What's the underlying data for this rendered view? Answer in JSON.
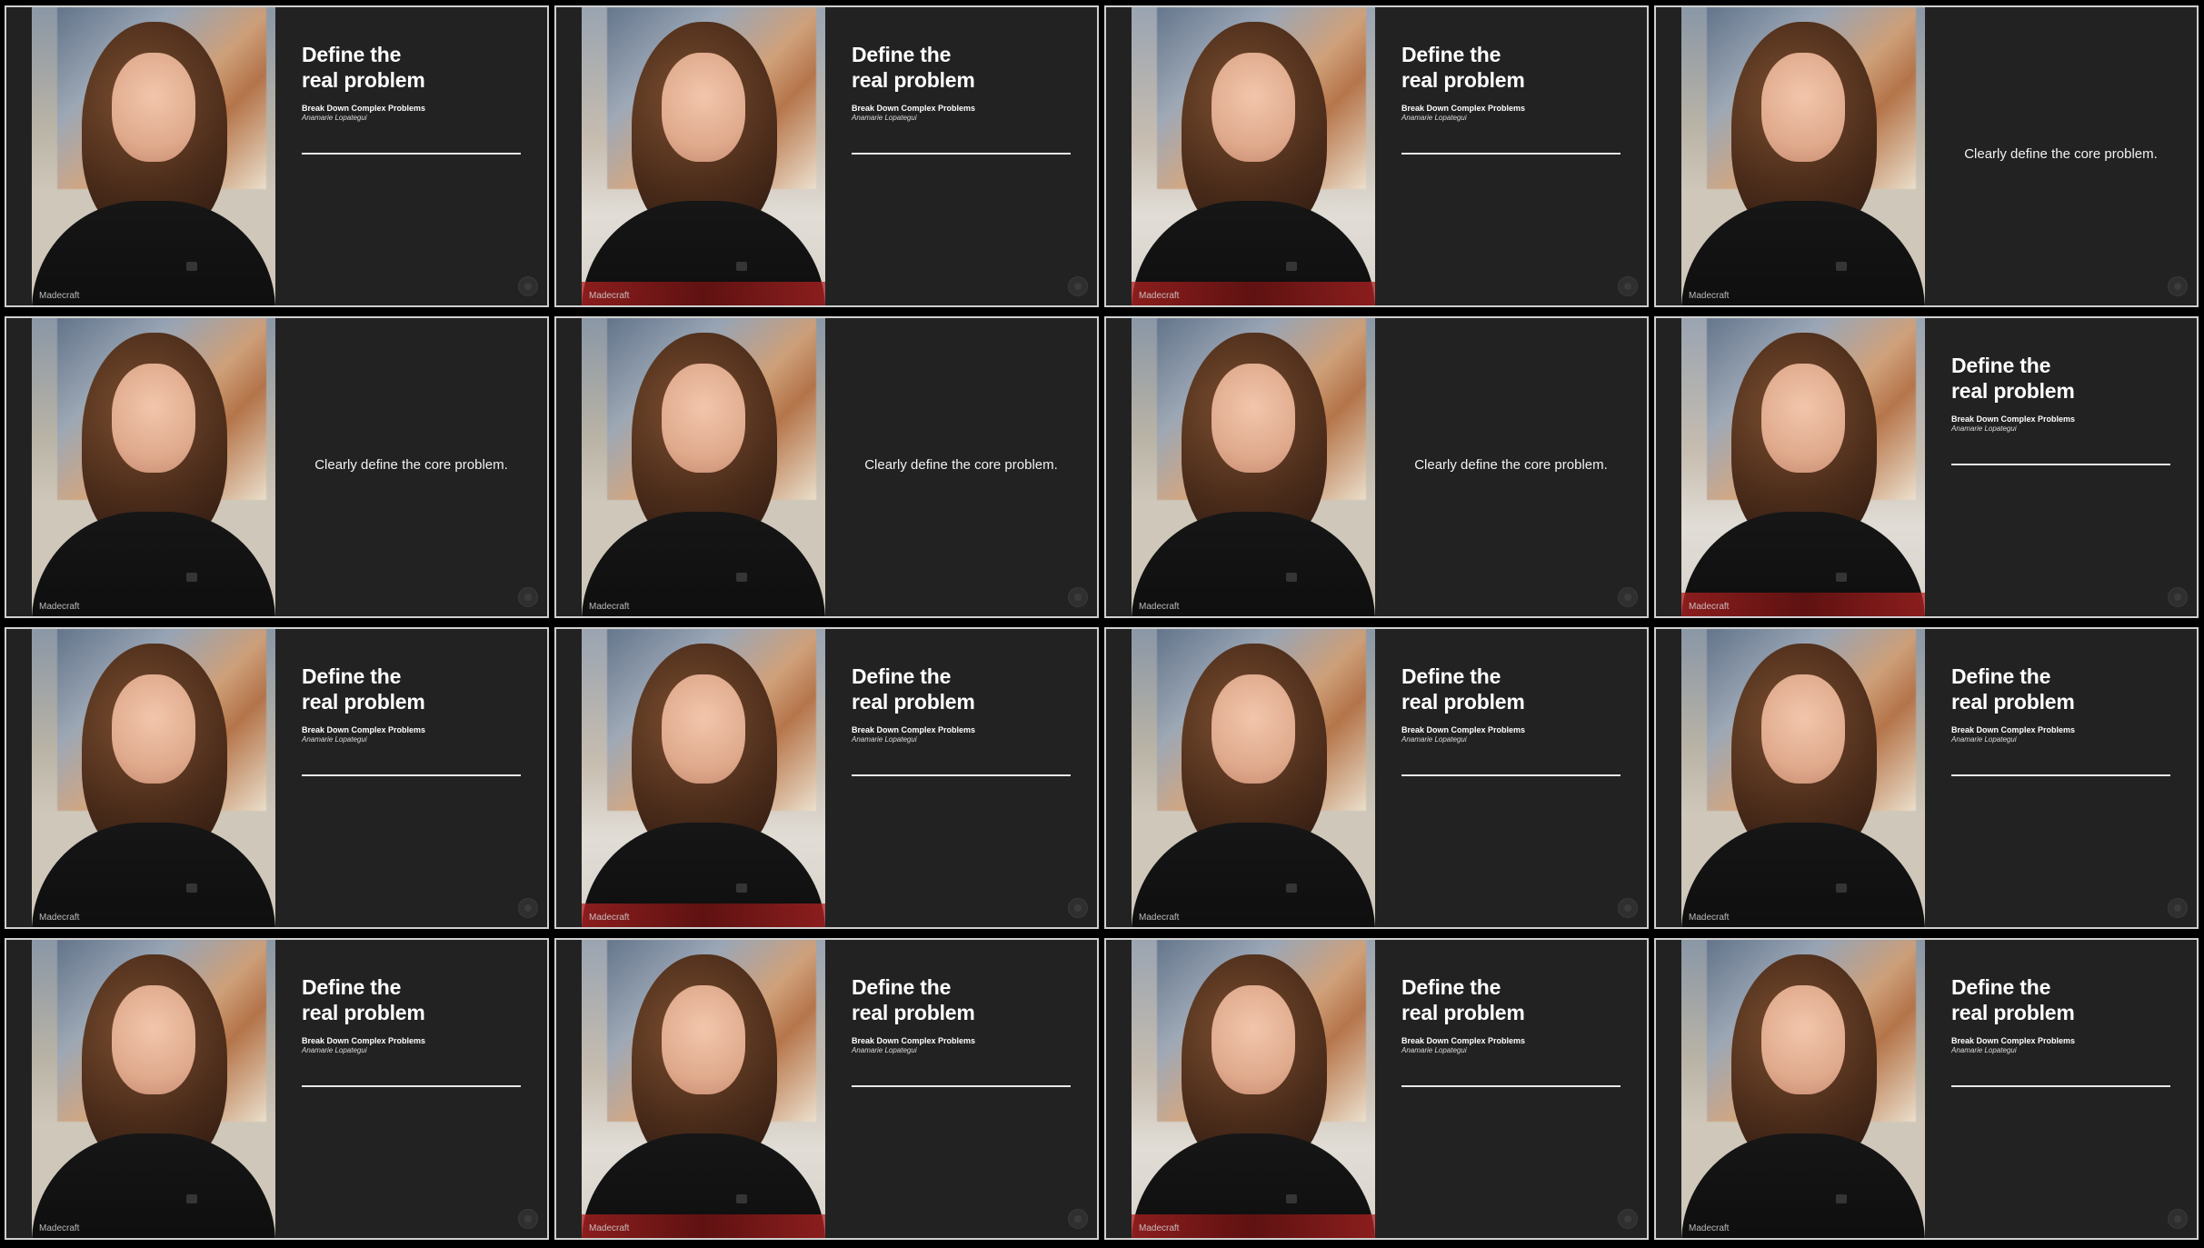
{
  "frames": [
    {
      "type": "title",
      "title": "Define the\nreal problem",
      "subtitle": "Break Down Complex Problems",
      "author": "Anamarie Lopategui",
      "logo": "Madecraft"
    },
    {
      "type": "title",
      "title": "Define the\nreal problem",
      "subtitle": "Break Down Complex Problems",
      "author": "Anamarie Lopategui",
      "logo": "Madecraft"
    },
    {
      "type": "title",
      "title": "Define the\nreal problem",
      "subtitle": "Break Down Complex Problems",
      "author": "Anamarie Lopategui",
      "logo": "Madecraft"
    },
    {
      "type": "quote",
      "quote": "Clearly define the core problem.",
      "logo": "Madecraft"
    },
    {
      "type": "quote",
      "quote": "Clearly define the core problem.",
      "logo": "Madecraft"
    },
    {
      "type": "quote",
      "quote": "Clearly define the core problem.",
      "logo": "Madecraft"
    },
    {
      "type": "quote",
      "quote": "Clearly define the core problem.",
      "logo": "Madecraft"
    },
    {
      "type": "title",
      "title": "Define the\nreal problem",
      "subtitle": "Break Down Complex Problems",
      "author": "Anamarie Lopategui",
      "logo": "Madecraft"
    },
    {
      "type": "title",
      "title": "Define the\nreal problem",
      "subtitle": "Break Down Complex Problems",
      "author": "Anamarie Lopategui",
      "logo": "Madecraft"
    },
    {
      "type": "title",
      "title": "Define the\nreal problem",
      "subtitle": "Break Down Complex Problems",
      "author": "Anamarie Lopategui",
      "logo": "Madecraft"
    },
    {
      "type": "title",
      "title": "Define the\nreal problem",
      "subtitle": "Break Down Complex Problems",
      "author": "Anamarie Lopategui",
      "logo": "Madecraft"
    },
    {
      "type": "title",
      "title": "Define the\nreal problem",
      "subtitle": "Break Down Complex Problems",
      "author": "Anamarie Lopategui",
      "logo": "Madecraft"
    },
    {
      "type": "title",
      "title": "Define the\nreal problem",
      "subtitle": "Break Down Complex Problems",
      "author": "Anamarie Lopategui",
      "logo": "Madecraft"
    },
    {
      "type": "title",
      "title": "Define the\nreal problem",
      "subtitle": "Break Down Complex Problems",
      "author": "Anamarie Lopategui",
      "logo": "Madecraft"
    },
    {
      "type": "title",
      "title": "Define the\nreal problem",
      "subtitle": "Break Down Complex Problems",
      "author": "Anamarie Lopategui",
      "logo": "Madecraft"
    },
    {
      "type": "title",
      "title": "Define the\nreal problem",
      "subtitle": "Break Down Complex Problems",
      "author": "Anamarie Lopategui",
      "logo": "Madecraft"
    }
  ]
}
